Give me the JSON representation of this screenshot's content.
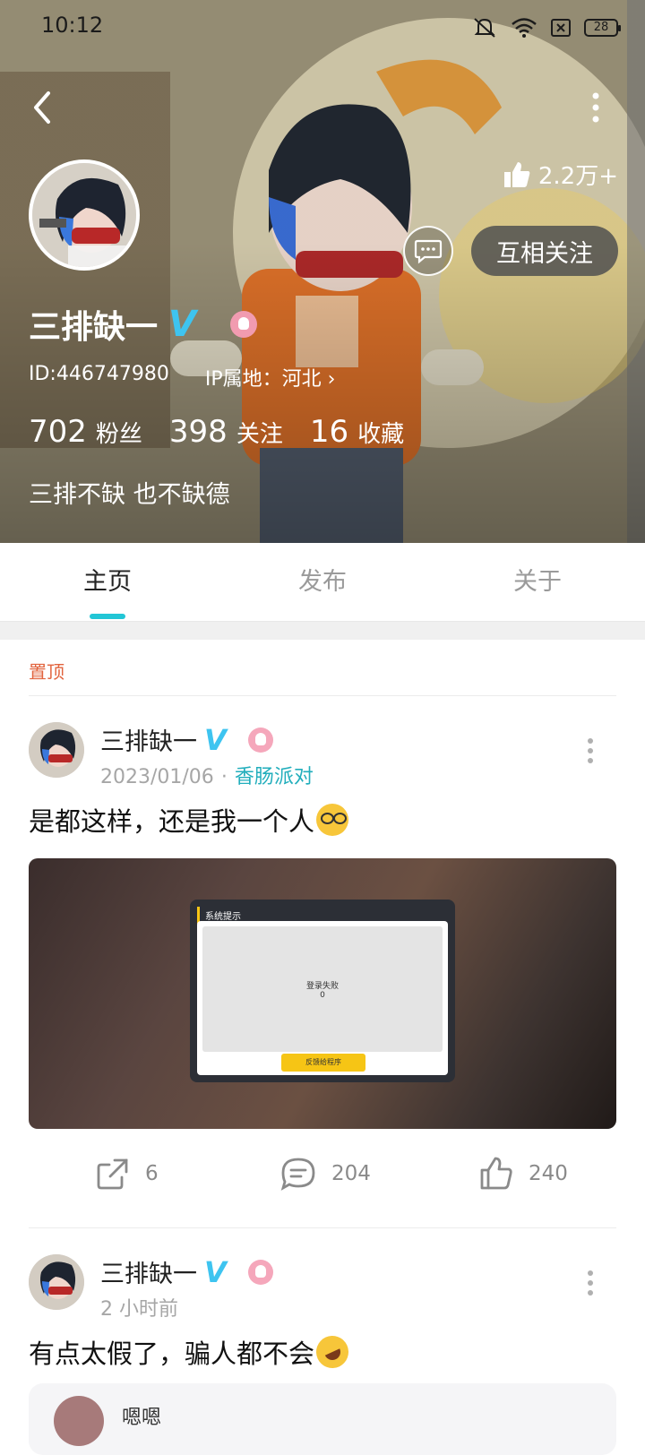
{
  "status_bar": {
    "time": "10:12",
    "battery": "28"
  },
  "profile": {
    "likes": "2.2万+",
    "follow_label": "互相关注",
    "name": "三排缺一",
    "verified_mark": "V",
    "id_text": "ID:446747980",
    "ip_text": "IP属地：河北 ›",
    "stats": [
      {
        "num": "702",
        "label": "粉丝"
      },
      {
        "num": "398",
        "label": "关注"
      },
      {
        "num": "16",
        "label": "收藏"
      }
    ],
    "bio": "三排不缺 也不缺德"
  },
  "tabs": [
    {
      "label": "主页",
      "active": true
    },
    {
      "label": "发布",
      "active": false
    },
    {
      "label": "关于",
      "active": false
    }
  ],
  "pinned_label": "置顶",
  "posts": [
    {
      "author": "三排缺一",
      "verified_mark": "V",
      "date": "2023/01/06",
      "dot": "·",
      "topic": "香肠派对",
      "text": "是都这样，还是我一个人",
      "image": {
        "dialog_title": "系统提示",
        "message": "登录失败",
        "code": "0",
        "button": "反馈给程序"
      },
      "shares": "6",
      "comments": "204",
      "likes": "240"
    },
    {
      "author": "三排缺一",
      "verified_mark": "V",
      "date": "2 小时前",
      "text": "有点太假了，骗人都不会",
      "repost_name": "嗯嗯"
    }
  ]
}
